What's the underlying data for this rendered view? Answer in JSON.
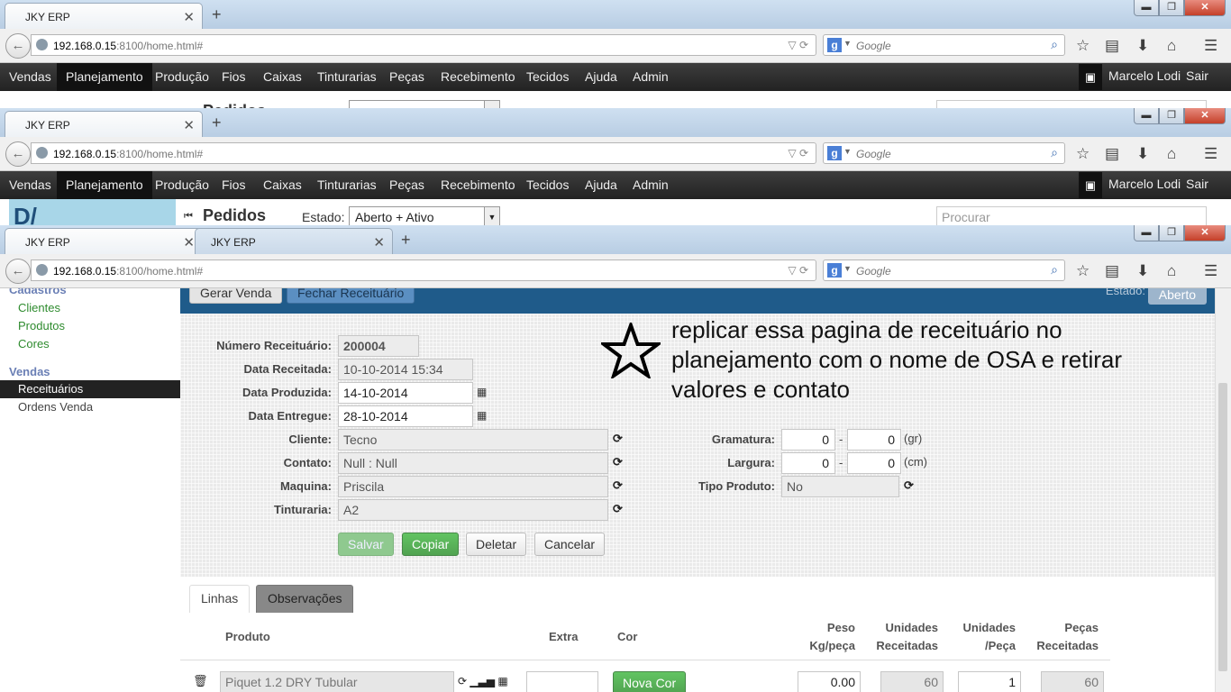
{
  "window": {
    "tab_title": "JKY ERP",
    "second_tab_title": "JKY ERP"
  },
  "browser": {
    "url_host": "192.168.0.15",
    "url_path": ":8100/home.html#",
    "search_engine": "Google",
    "search_placeholder": "Google"
  },
  "menu": [
    "Vendas",
    "Planejamento",
    "Produção",
    "Fios",
    "Caixas",
    "Tinturarias",
    "Peças",
    "Recebimento",
    "Tecidos",
    "Ajuda",
    "Admin"
  ],
  "user": {
    "name": "Marcelo Lodi",
    "logout": "Sair"
  },
  "pedidos": {
    "title": "Pedidos",
    "estado_label": "Estado:",
    "estado_value": "Aberto + Ativo",
    "search_placeholder": "Procurar"
  },
  "sidebar": {
    "cadastros_label": "Cadastros",
    "cadastros_items": [
      "Clientes",
      "Produtos",
      "Cores"
    ],
    "vendas_label": "Vendas",
    "vendas_items": [
      "Receituários",
      "Ordens Venda"
    ]
  },
  "toolbar": {
    "gerar_venda": "Gerar Venda",
    "fechar": "Fechar Receituário",
    "estado_label": "Estado:",
    "estado_value": "Aberto"
  },
  "form": {
    "numero_label": "Número Receituário:",
    "numero": "200004",
    "data_receitada_label": "Data Receitada:",
    "data_receitada": "10-10-2014 15:34",
    "data_produzida_label": "Data Produzida:",
    "data_produzida": "14-10-2014",
    "data_entregue_label": "Data Entregue:",
    "data_entregue": "28-10-2014",
    "cliente_label": "Cliente:",
    "cliente": "Tecno",
    "contato_label": "Contato:",
    "contato": "Null : Null",
    "maquina_label": "Maquina:",
    "maquina": "Priscila",
    "tinturaria_label": "Tinturaria:",
    "tinturaria": "A2",
    "gramatura_label": "Gramatura:",
    "gramatura_from": "0",
    "gramatura_to": "0",
    "gramatura_unit": "(gr)",
    "largura_label": "Largura:",
    "largura_from": "0",
    "largura_to": "0",
    "largura_unit": "(cm)",
    "tipo_produto_label": "Tipo Produto:",
    "tipo_produto": "No",
    "dash": "-"
  },
  "actions": {
    "salvar": "Salvar",
    "copiar": "Copiar",
    "deletar": "Deletar",
    "cancelar": "Cancelar"
  },
  "annotation": "replicar essa pagina de receituário no planejamento com o nome de OSA e retirar valores e contato",
  "tabs": {
    "linhas": "Linhas",
    "observacoes": "Observações"
  },
  "grid": {
    "headers": {
      "produto": "Produto",
      "extra": "Extra",
      "cor": "Cor",
      "peso_1": "Peso",
      "peso_2": "Kg/peça",
      "unid_rec_1": "Unidades",
      "unid_rec_2": "Receitadas",
      "unid_peca_1": "Unidades",
      "unid_peca_2": "/Peça",
      "pecas_1": "Peças",
      "pecas_2": "Receitadas"
    },
    "row": {
      "produto": "Piquet 1.2 DRY Tubular",
      "extra": "",
      "cor_button": "Nova Cor",
      "peso": "0.00",
      "unidades_receitadas": "60",
      "unidades_peca": "1",
      "pecas_receitadas": "60"
    }
  }
}
